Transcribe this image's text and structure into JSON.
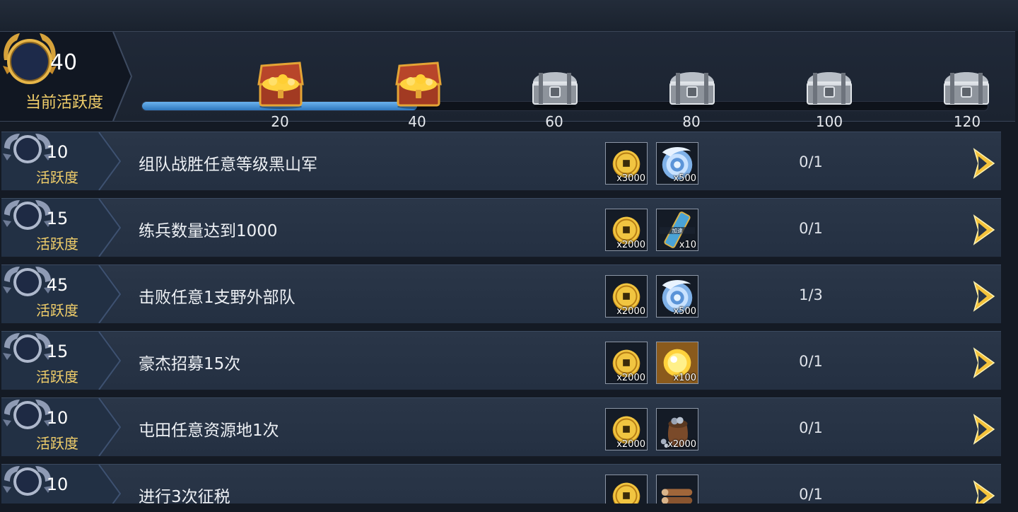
{
  "header": {
    "current_activity_value": "40",
    "current_activity_label": "当前活跃度",
    "progress_fraction": 0.325,
    "milestones": [
      {
        "value": "20",
        "chest": "gold-chest-icon"
      },
      {
        "value": "40",
        "chest": "gold-chest-icon"
      },
      {
        "value": "60",
        "chest": "silver-chest-icon"
      },
      {
        "value": "80",
        "chest": "silver-chest-icon"
      },
      {
        "value": "100",
        "chest": "silver-chest-icon"
      },
      {
        "value": "120",
        "chest": "silver-chest-icon"
      }
    ]
  },
  "activity_label": "活跃度",
  "tasks": [
    {
      "points": "10",
      "title": "组队战胜任意等级黑山军",
      "progress": "0/1",
      "rewards": [
        {
          "icon": "copper-coin-icon",
          "qty": "x3000"
        },
        {
          "icon": "blue-cloud-icon",
          "qty": "x500"
        }
      ]
    },
    {
      "points": "15",
      "title": "练兵数量达到1000",
      "progress": "0/1",
      "rewards": [
        {
          "icon": "copper-coin-icon",
          "qty": "x2000"
        },
        {
          "icon": "speedup-token-icon",
          "qty": "x10"
        }
      ]
    },
    {
      "points": "45",
      "title": "击败任意1支野外部队",
      "progress": "1/3",
      "rewards": [
        {
          "icon": "copper-coin-icon",
          "qty": "x2000"
        },
        {
          "icon": "blue-cloud-icon",
          "qty": "x500"
        }
      ]
    },
    {
      "points": "15",
      "title": "豪杰招募15次",
      "progress": "0/1",
      "rewards": [
        {
          "icon": "copper-coin-icon",
          "qty": "x2000"
        },
        {
          "icon": "gold-orb-icon",
          "qty": "x100"
        }
      ]
    },
    {
      "points": "10",
      "title": "屯田任意资源地1次",
      "progress": "0/1",
      "rewards": [
        {
          "icon": "copper-coin-icon",
          "qty": "x2000"
        },
        {
          "icon": "iron-ore-sack-icon",
          "qty": "x2000"
        }
      ]
    },
    {
      "points": "10",
      "title": "进行3次征税",
      "progress": "0/1",
      "rewards": [
        {
          "icon": "copper-coin-icon",
          "qty": ""
        },
        {
          "icon": "wood-logs-icon",
          "qty": ""
        }
      ]
    }
  ],
  "colors": {
    "accent_gold": "#f2cf6a",
    "progress_blue": "#4a9be0",
    "row_bg": "#273346"
  }
}
